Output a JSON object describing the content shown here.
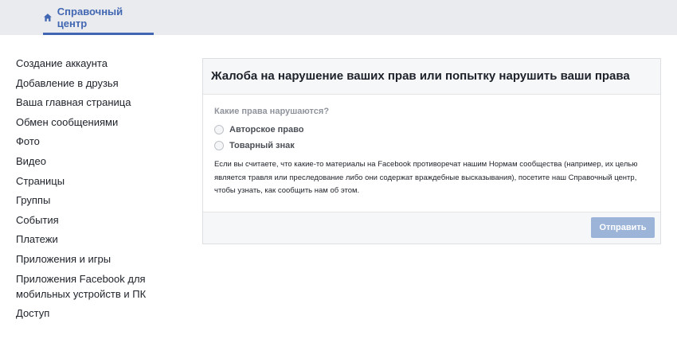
{
  "header": {
    "help_center_label": "Справочный центр",
    "accent_color": "#4267b2",
    "icon": "home-icon"
  },
  "sidebar": {
    "items": [
      {
        "label": "Создание аккаунта"
      },
      {
        "label": "Добавление в друзья"
      },
      {
        "label": "Ваша главная страница"
      },
      {
        "label": "Обмен сообщениями"
      },
      {
        "label": "Фото"
      },
      {
        "label": "Видео"
      },
      {
        "label": "Страницы"
      },
      {
        "label": "Группы"
      },
      {
        "label": "События"
      },
      {
        "label": "Платежи"
      },
      {
        "label": "Приложения и игры"
      },
      {
        "label": "Приложения Facebook для мобильных устройств и ПК"
      },
      {
        "label": "Доступ"
      }
    ]
  },
  "form": {
    "title": "Жалоба на нарушение ваших прав или попытку нарушить ваши права",
    "question": "Какие права нарушаются?",
    "options": [
      {
        "label": "Авторское право",
        "selected": false
      },
      {
        "label": "Товарный знак",
        "selected": false
      }
    ],
    "description": "Если вы считаете, что какие-то материалы на Facebook противоречат нашим Нормам сообщества (например, их целью является травля или преследование либо они содержат враждебные высказывания), посетите наш Справочный центр, чтобы узнать, как сообщить нам об этом.",
    "submit_label": "Отправить",
    "submit_color": "#9cb4d8"
  }
}
